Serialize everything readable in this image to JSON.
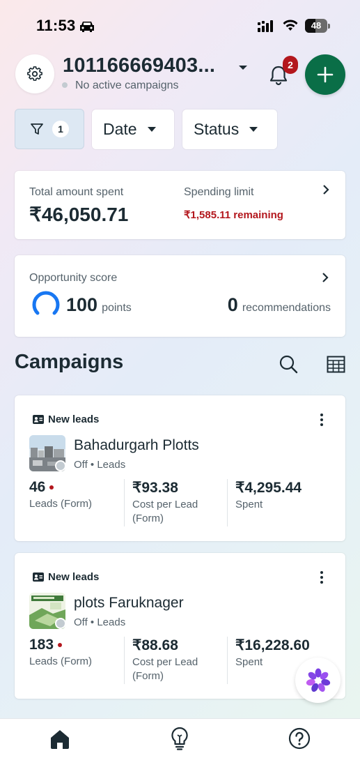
{
  "status_bar": {
    "time": "11:53",
    "battery": "48"
  },
  "header": {
    "account_name": "101166669403...",
    "account_status": "No active campaigns",
    "notification_count": "2"
  },
  "filters": {
    "active_count": "1",
    "date_label": "Date",
    "status_label": "Status"
  },
  "spend_card": {
    "total_label": "Total amount spent",
    "total_value": "₹46,050.71",
    "limit_label": "Spending limit",
    "limit_remaining": "₹1,585.11 remaining"
  },
  "opportunity_card": {
    "label": "Opportunity score",
    "score": "100",
    "score_unit": "points",
    "recommendations": "0",
    "recommendations_unit": "recommendations"
  },
  "campaigns": {
    "title": "Campaigns",
    "items": [
      {
        "objective": "New leads",
        "name": "Bahadurgarh Plotts",
        "status": "Off",
        "type": "Leads",
        "results": "46",
        "results_label": "Leads (Form)",
        "cost": "₹93.38",
        "cost_label": "Cost per Lead (Form)",
        "spent": "₹4,295.44",
        "spent_label": "Spent"
      },
      {
        "objective": "New leads",
        "name": "plots Faruknager",
        "status": "Off",
        "type": "Leads",
        "results": "183",
        "results_label": "Leads (Form)",
        "cost": "₹88.68",
        "cost_label": "Cost per Lead (Form)",
        "spent": "₹16,228.60",
        "spent_label": "Spent"
      }
    ]
  },
  "colors": {
    "primary_green": "#0a6e47",
    "alert_red": "#b3171d",
    "text_dark": "#1c2b33",
    "text_muted": "#55626b",
    "score_blue": "#1877f2"
  },
  "icons": [
    "car-icon",
    "signal-icon",
    "wifi-icon",
    "battery-icon",
    "gear-icon",
    "chevron-down-icon",
    "bell-icon",
    "plus-icon",
    "filter-icon",
    "chevron-right-icon",
    "search-icon",
    "table-icon",
    "lead-form-icon",
    "more-vertical-icon",
    "assistant-icon",
    "home-icon",
    "lightbulb-icon",
    "help-icon"
  ],
  "opportunity_progress": 1.0
}
